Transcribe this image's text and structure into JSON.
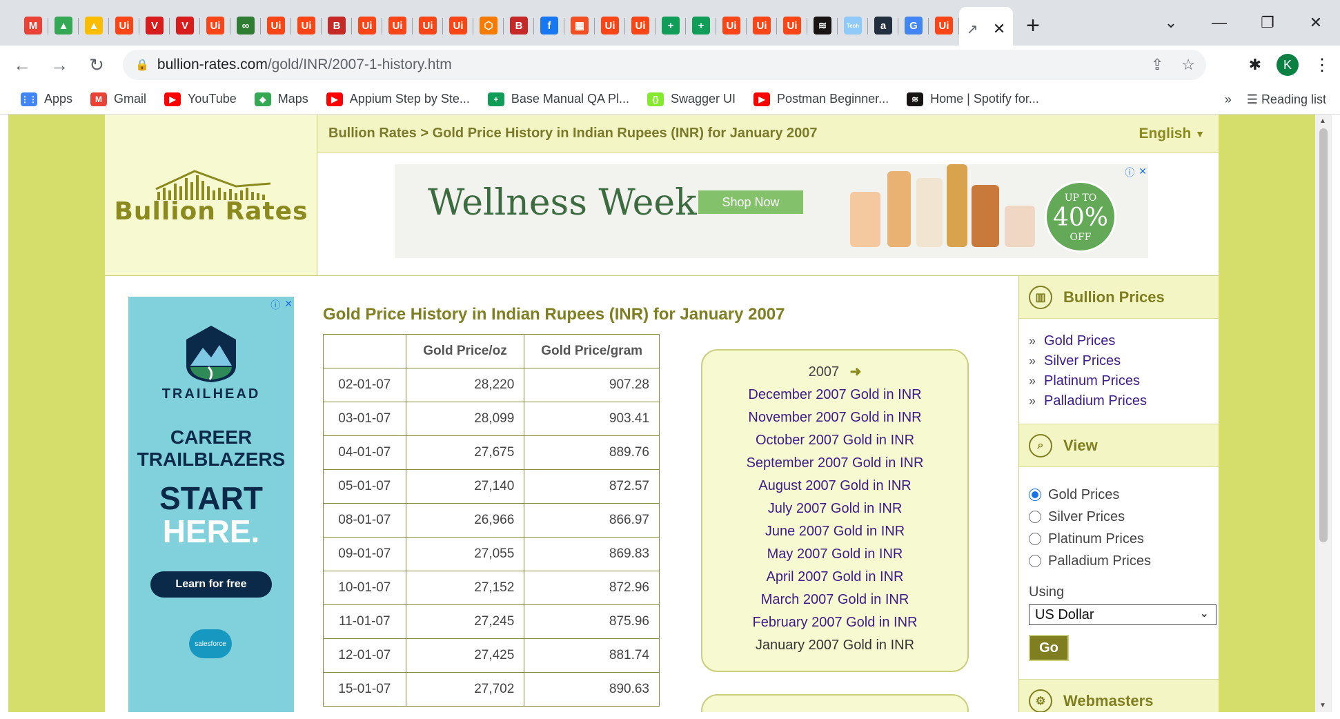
{
  "browser": {
    "tab_favicons": [
      {
        "icon": "gmail-icon",
        "glyph": "M",
        "color": "#ea4335"
      },
      {
        "icon": "drive-icon",
        "glyph": "▲",
        "color": "#34a853"
      },
      {
        "icon": "drive-icon",
        "glyph": "▲",
        "color": "#fbbc04"
      },
      {
        "icon": "uipath-icon",
        "glyph": "Ui",
        "color": "#fa4616"
      },
      {
        "icon": "vivaldi-icon",
        "glyph": "V",
        "color": "#d81b1b"
      },
      {
        "icon": "vivaldi-icon",
        "glyph": "V",
        "color": "#d81b1b"
      },
      {
        "icon": "uipath-icon",
        "glyph": "Ui",
        "color": "#fa4616"
      },
      {
        "icon": "link-icon",
        "glyph": "∞",
        "color": "#2e7d32"
      },
      {
        "icon": "uipath-icon",
        "glyph": "Ui",
        "color": "#fa4616"
      },
      {
        "icon": "uipath-icon",
        "glyph": "Ui",
        "color": "#fa4616"
      },
      {
        "icon": "bold-b-icon",
        "glyph": "B",
        "color": "#c62828"
      },
      {
        "icon": "uipath-icon",
        "glyph": "Ui",
        "color": "#fa4616"
      },
      {
        "icon": "uipath-icon",
        "glyph": "Ui",
        "color": "#fa4616"
      },
      {
        "icon": "uipath-icon",
        "glyph": "Ui",
        "color": "#fa4616"
      },
      {
        "icon": "uipath-icon",
        "glyph": "Ui",
        "color": "#fa4616"
      },
      {
        "icon": "hexagon-icon",
        "glyph": "⬡",
        "color": "#f57c00"
      },
      {
        "icon": "bold-b-icon",
        "glyph": "B",
        "color": "#c62828"
      },
      {
        "icon": "facebook-icon",
        "glyph": "f",
        "color": "#1877f2"
      },
      {
        "icon": "microsoft-icon",
        "glyph": "▦",
        "color": "#f25022"
      },
      {
        "icon": "uipath-icon",
        "glyph": "Ui",
        "color": "#fa4616"
      },
      {
        "icon": "uipath-icon",
        "glyph": "Ui",
        "color": "#fa4616"
      },
      {
        "icon": "sheets-plus-icon",
        "glyph": "+",
        "color": "#0f9d58"
      },
      {
        "icon": "sheets-plus-icon",
        "glyph": "+",
        "color": "#0f9d58"
      },
      {
        "icon": "uipath-icon",
        "glyph": "Ui",
        "color": "#fa4616"
      },
      {
        "icon": "uipath-icon",
        "glyph": "Ui",
        "color": "#fa4616"
      },
      {
        "icon": "uipath-icon",
        "glyph": "Ui",
        "color": "#fa4616"
      },
      {
        "icon": "spotify-icon",
        "glyph": "≋",
        "color": "#191414"
      },
      {
        "icon": "tech-icon",
        "glyph": "Tech",
        "color": "#90caf9"
      },
      {
        "icon": "amazon-icon",
        "glyph": "a",
        "color": "#232f3e"
      },
      {
        "icon": "google-icon",
        "glyph": "G",
        "color": "#4285f4"
      },
      {
        "icon": "uipath-icon",
        "glyph": "Ui",
        "color": "#fa4616"
      }
    ],
    "active_tab_icon": "chart-icon",
    "url_host": "bullion-rates.com",
    "url_path": "/gold/INR/2007-1-history.htm",
    "avatar_letter": "K",
    "bookmarks": [
      {
        "label": "Apps",
        "icon": "apps-grid-icon",
        "color": "#4285f4",
        "glyph": "⋮⋮"
      },
      {
        "label": "Gmail",
        "icon": "gmail-icon",
        "color": "#ea4335",
        "glyph": "M"
      },
      {
        "label": "YouTube",
        "icon": "youtube-icon",
        "color": "#ff0000",
        "glyph": "▶"
      },
      {
        "label": "Maps",
        "icon": "maps-icon",
        "color": "#34a853",
        "glyph": "◆"
      },
      {
        "label": "Appium Step by Ste...",
        "icon": "youtube-icon",
        "color": "#ff0000",
        "glyph": "▶"
      },
      {
        "label": "Base Manual QA Pl...",
        "icon": "sheets-plus-icon",
        "color": "#0f9d58",
        "glyph": "+"
      },
      {
        "label": "Swagger UI",
        "icon": "swagger-icon",
        "color": "#85ea2d",
        "glyph": "{}"
      },
      {
        "label": "Postman Beginner...",
        "icon": "youtube-icon",
        "color": "#ff0000",
        "glyph": "▶"
      },
      {
        "label": "Home | Spotify for...",
        "icon": "spotify-icon",
        "color": "#191414",
        "glyph": "≋"
      }
    ],
    "reading_list": "Reading list"
  },
  "site": {
    "logo_text": "Bullion  Rates",
    "breadcrumb": "Bullion Rates > Gold Price History in Indian Rupees (INR) for January 2007",
    "language": "English",
    "ad_banner": {
      "title": "Wellness Week",
      "button": "Shop Now",
      "badge_top": "UP TO",
      "badge_pct": "40%",
      "badge_bottom": "OFF"
    },
    "left_ad": {
      "brand": "TRAILHEAD",
      "line1": "CAREER",
      "line2": "TRAILBLAZERS",
      "line3": "START",
      "line4": "HERE.",
      "cta": "Learn for free",
      "logo": "salesforce"
    },
    "page_title": "Gold Price History in Indian Rupees (INR) for January 2007",
    "table": {
      "headers": [
        "",
        "Gold Price/oz",
        "Gold Price/gram"
      ],
      "rows": [
        [
          "02-01-07",
          "28,220",
          "907.28"
        ],
        [
          "03-01-07",
          "28,099",
          "903.41"
        ],
        [
          "04-01-07",
          "27,675",
          "889.76"
        ],
        [
          "05-01-07",
          "27,140",
          "872.57"
        ],
        [
          "08-01-07",
          "26,966",
          "866.97"
        ],
        [
          "09-01-07",
          "27,055",
          "869.83"
        ],
        [
          "10-01-07",
          "27,152",
          "872.96"
        ],
        [
          "11-01-07",
          "27,245",
          "875.96"
        ],
        [
          "12-01-07",
          "27,425",
          "881.74"
        ],
        [
          "15-01-07",
          "27,702",
          "890.63"
        ]
      ]
    },
    "month_box": {
      "year": "2007",
      "links": [
        "December 2007 Gold in INR",
        "November 2007 Gold in INR",
        "October 2007 Gold in INR",
        "September 2007 Gold in INR",
        "August 2007 Gold in INR",
        "July 2007 Gold in INR",
        "June 2007 Gold in INR",
        "May 2007 Gold in INR",
        "April 2007 Gold in INR",
        "March 2007 Gold in INR",
        "February 2007 Gold in INR",
        "January 2007 Gold in INR"
      ]
    },
    "sidebar": {
      "bullion_heading": "Bullion Prices",
      "bullion_links": [
        "Gold Prices",
        "Silver Prices",
        "Platinum Prices",
        "Palladium Prices"
      ],
      "view_heading": "View",
      "view_options": [
        "Gold Prices",
        "Silver Prices",
        "Platinum Prices",
        "Palladium Prices"
      ],
      "view_selected": 0,
      "using_label": "Using",
      "currency": "US Dollar",
      "go_label": "Go",
      "webmasters_heading": "Webmasters"
    }
  }
}
